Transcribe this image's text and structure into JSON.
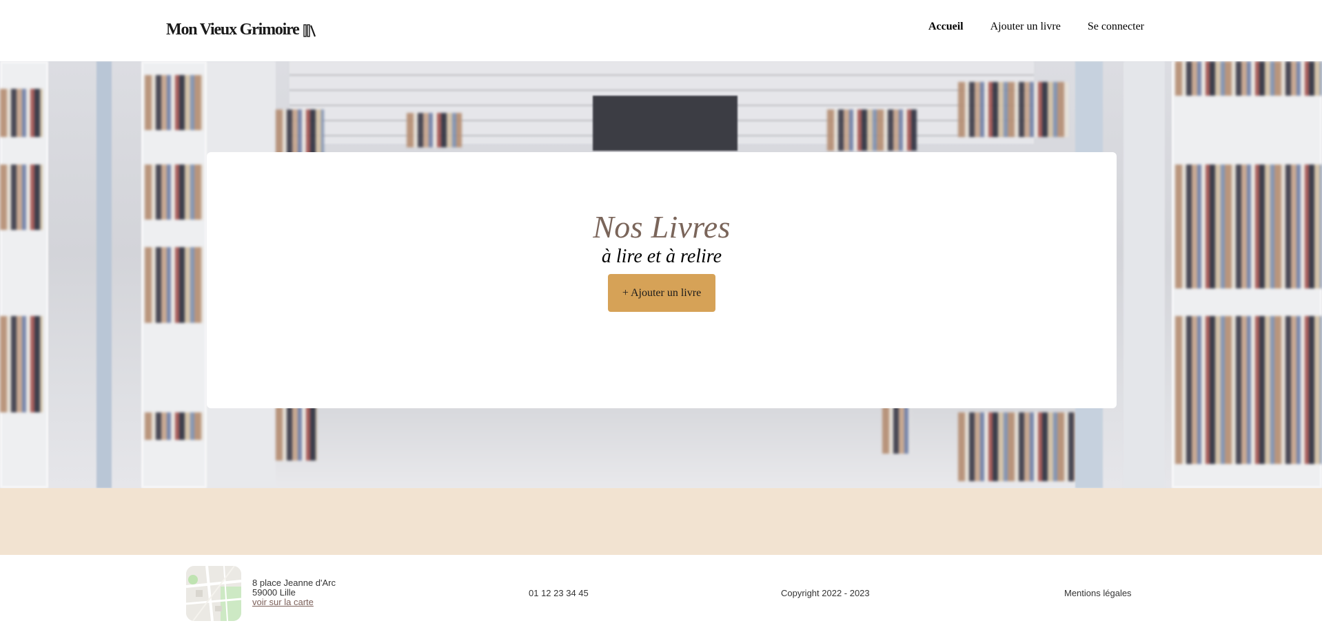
{
  "header": {
    "logo_text": "Mon Vieux Grimoire",
    "logo_icon": "books-icon",
    "nav": [
      {
        "label": "Accueil",
        "active": true
      },
      {
        "label": "Ajouter un livre",
        "active": false
      },
      {
        "label": "Se connecter",
        "active": false
      }
    ]
  },
  "hero": {
    "background": "library-bookshelves-photo",
    "title": "Nos Livres",
    "subtitle": "à lire et à relire",
    "add_button_label": "+ Ajouter un livre"
  },
  "footer": {
    "map_icon": "map-thumbnail",
    "address_line1": "8 place Jeanne d'Arc",
    "address_line2": "59000 Lille",
    "map_link": "voir sur la carte",
    "phone": "01 12 23 34 45",
    "copyright": "Copyright 2022 - 2023",
    "legal": "Mentions légales"
  },
  "colors": {
    "accent_button": "#d6a257",
    "title": "#7a655a",
    "band": "#f2e3d1",
    "link": "#7b5f58"
  }
}
